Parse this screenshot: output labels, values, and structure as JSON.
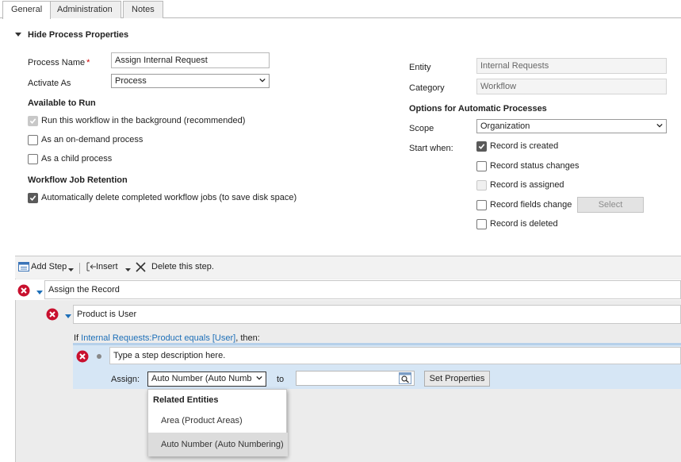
{
  "tabs": [
    {
      "label": "General",
      "active": true
    },
    {
      "label": "Administration",
      "active": false
    },
    {
      "label": "Notes",
      "active": false
    }
  ],
  "properties": {
    "section_title": "Hide Process Properties",
    "process_name_label": "Process Name",
    "process_name_value": "Assign Internal Request",
    "activate_as_label": "Activate As",
    "activate_as_value": "Process",
    "available_title": "Available to Run",
    "run_background": {
      "label": "Run this workflow in the background (recommended)",
      "checked": true,
      "disabled": true
    },
    "on_demand": {
      "label": "As an on-demand process",
      "checked": false
    },
    "child_process": {
      "label": "As a child process",
      "checked": false
    },
    "retention_title": "Workflow Job Retention",
    "auto_delete": {
      "label": "Automatically delete completed workflow jobs (to save disk space)",
      "checked": true
    },
    "entity_label": "Entity",
    "entity_value": "Internal Requests",
    "category_label": "Category",
    "category_value": "Workflow",
    "options_title": "Options for Automatic Processes",
    "scope_label": "Scope",
    "scope_value": "Organization",
    "start_when_label": "Start when:",
    "start_options": [
      {
        "label": "Record is created",
        "checked": true,
        "disabled": false
      },
      {
        "label": "Record status changes",
        "checked": false,
        "disabled": false
      },
      {
        "label": "Record is assigned",
        "checked": false,
        "disabled": true
      },
      {
        "label": "Record fields change",
        "checked": false,
        "disabled": false
      },
      {
        "label": "Record is deleted",
        "checked": false,
        "disabled": false
      }
    ],
    "select_button": "Select"
  },
  "toolbar": {
    "add_step": "Add Step",
    "insert": "Insert",
    "delete_step": "Delete this step."
  },
  "steps": {
    "assign_record": "Assign the Record",
    "condition_title": "Product is User",
    "condition_prefix": "If ",
    "condition_link": "Internal Requests:Product equals [User]",
    "condition_suffix": ", then:",
    "step_description_placeholder": "Type a step description here.",
    "assign_label": "Assign:",
    "assign_value": "Auto Number (Auto Numb",
    "to_label": "to",
    "to_value": "",
    "set_properties_button": "Set Properties"
  },
  "dropdown": {
    "header": "Related Entities",
    "items": [
      "Area (Product Areas)",
      "Auto Number (Auto Numbering)"
    ]
  },
  "colors": {
    "accent": "#1d6fb8",
    "error": "#c8102e",
    "highlight_row": "#d6e6f5"
  }
}
